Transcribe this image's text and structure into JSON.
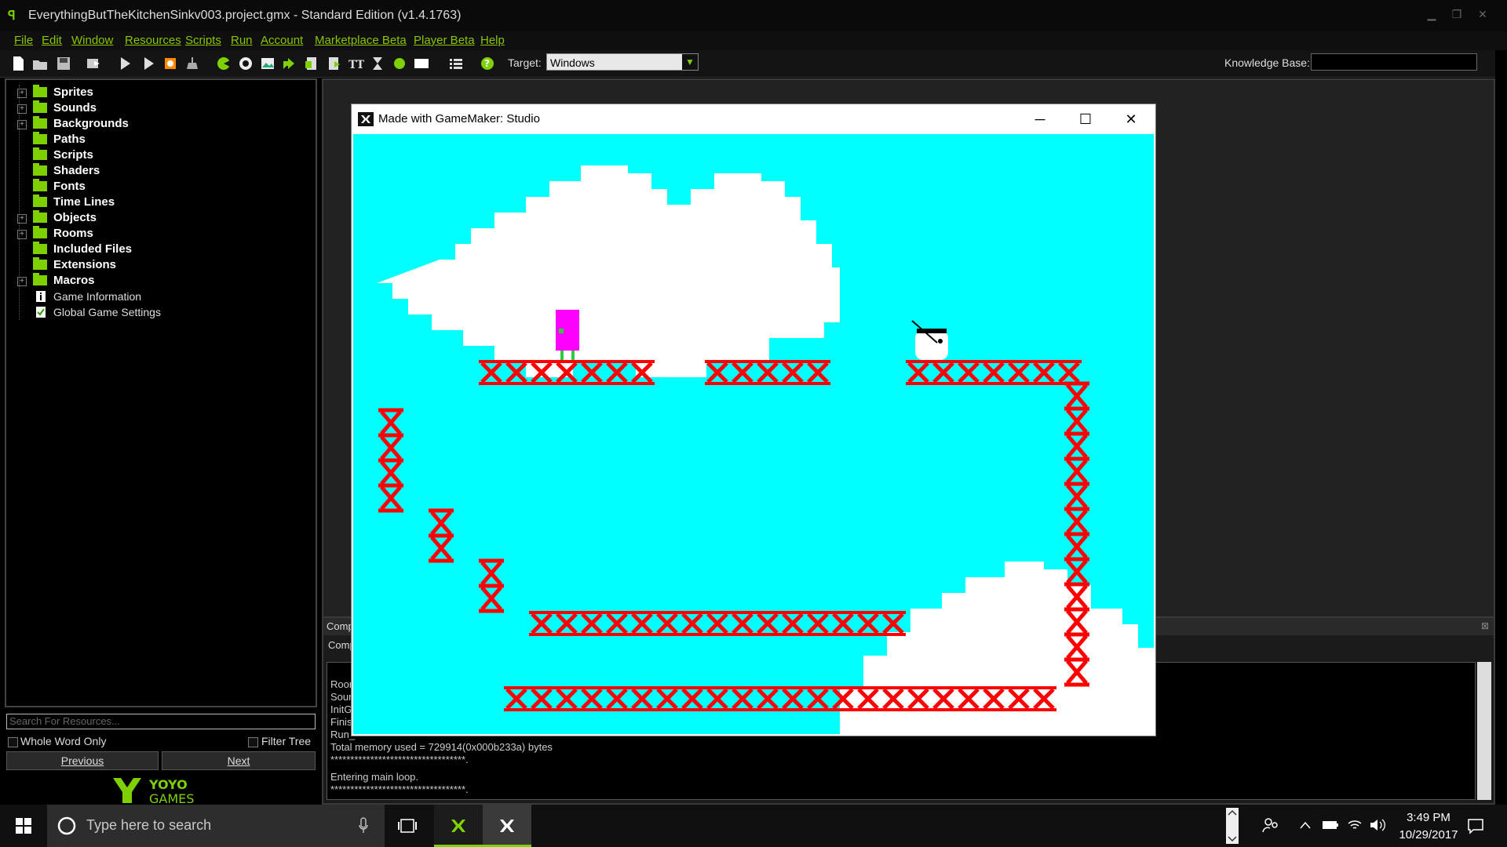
{
  "window": {
    "title": "EverythingButTheKitchenSinkv003.project.gmx  -  Standard Edition (v1.4.1763)",
    "controls": [
      "minimize-icon",
      "restore-icon",
      "close-icon"
    ]
  },
  "menu": [
    "File",
    "Edit",
    "Window",
    "Resources",
    "Scripts",
    "Run",
    "Account",
    "Marketplace Beta",
    "Player Beta",
    "Help"
  ],
  "toolbar": {
    "target_label": "Target:",
    "target_value": "Windows",
    "kb_label": "Knowledge Base:"
  },
  "tree": [
    {
      "label": "Sprites",
      "expandable": true,
      "kind": "folder"
    },
    {
      "label": "Sounds",
      "expandable": true,
      "kind": "folder"
    },
    {
      "label": "Backgrounds",
      "expandable": true,
      "kind": "folder"
    },
    {
      "label": "Paths",
      "expandable": false,
      "kind": "folder"
    },
    {
      "label": "Scripts",
      "expandable": false,
      "kind": "folder"
    },
    {
      "label": "Shaders",
      "expandable": false,
      "kind": "folder"
    },
    {
      "label": "Fonts",
      "expandable": false,
      "kind": "folder"
    },
    {
      "label": "Time Lines",
      "expandable": false,
      "kind": "folder"
    },
    {
      "label": "Objects",
      "expandable": true,
      "kind": "folder"
    },
    {
      "label": "Rooms",
      "expandable": true,
      "kind": "folder"
    },
    {
      "label": "Included Files",
      "expandable": false,
      "kind": "folder"
    },
    {
      "label": "Extensions",
      "expandable": false,
      "kind": "folder"
    },
    {
      "label": "Macros",
      "expandable": true,
      "kind": "folder"
    },
    {
      "label": "Game Information",
      "expandable": false,
      "kind": "info"
    },
    {
      "label": "Global Game Settings",
      "expandable": false,
      "kind": "settings"
    }
  ],
  "search": {
    "placeholder": "Search For Resources...",
    "whole_word": "Whole Word Only",
    "filter_tree": "Filter Tree",
    "prev": "Previous",
    "next": "Next"
  },
  "logo_text": "YOYO GAMES",
  "compile": {
    "tab1": "Comp",
    "tab2": "Comp",
    "log": [
      "Room",
      "Soun",
      "InitG",
      "Finish",
      "Run_",
      "Total memory used = 729914(0x000b233a) bytes",
      "**********************************.",
      "Entering main loop.",
      "**********************************."
    ]
  },
  "game_window": {
    "title": "Made with GameMaker: Studio"
  },
  "taskbar": {
    "search_placeholder": "Type here to search",
    "time": "3:49 PM",
    "date": "10/29/2017"
  },
  "colors": {
    "accent": "#7fd000",
    "sky": "#00ffff",
    "girder": "#ff0000",
    "player": "#ff00ff"
  }
}
